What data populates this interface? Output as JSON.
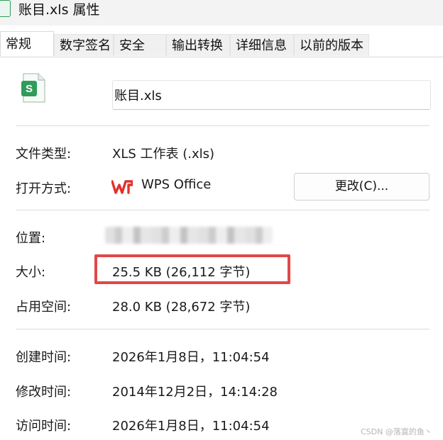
{
  "window": {
    "title": "账目.xls 属性"
  },
  "tabs": [
    {
      "label": "常规",
      "active": true
    },
    {
      "label": "数字签名"
    },
    {
      "label": "安全"
    },
    {
      "label": "输出转换"
    },
    {
      "label": "详细信息"
    },
    {
      "label": "以前的版本"
    }
  ],
  "file": {
    "name": "账目.xls",
    "icon": "spreadsheet-file-icon",
    "icon_letter": "S",
    "icon_color": "#2f9c5a"
  },
  "properties": {
    "type": {
      "label": "文件类型:",
      "value": "XLS 工作表 (.xls)"
    },
    "open_with": {
      "label": "打开方式:",
      "app": "WPS Office",
      "button": "更改(C)...",
      "logo_color": "#e4302b"
    },
    "location": {
      "label": "位置:",
      "value_obscured": true
    },
    "size": {
      "label": "大小:",
      "value": "25.5 KB (26,112 字节)",
      "highlight_color": "#e04848"
    },
    "size_on_disk": {
      "label": "占用空间:",
      "value": "28.0 KB (28,672 字节)"
    },
    "created": {
      "label": "创建时间:",
      "value": "2026年1月8日，11:04:54"
    },
    "modified": {
      "label": "修改时间:",
      "value": "2014年12月2日，14:14:28"
    },
    "accessed": {
      "label": "访问时间:",
      "value": "2026年1月8日，11:04:54"
    }
  },
  "watermark": "CSDN @落寞的鱼丶"
}
